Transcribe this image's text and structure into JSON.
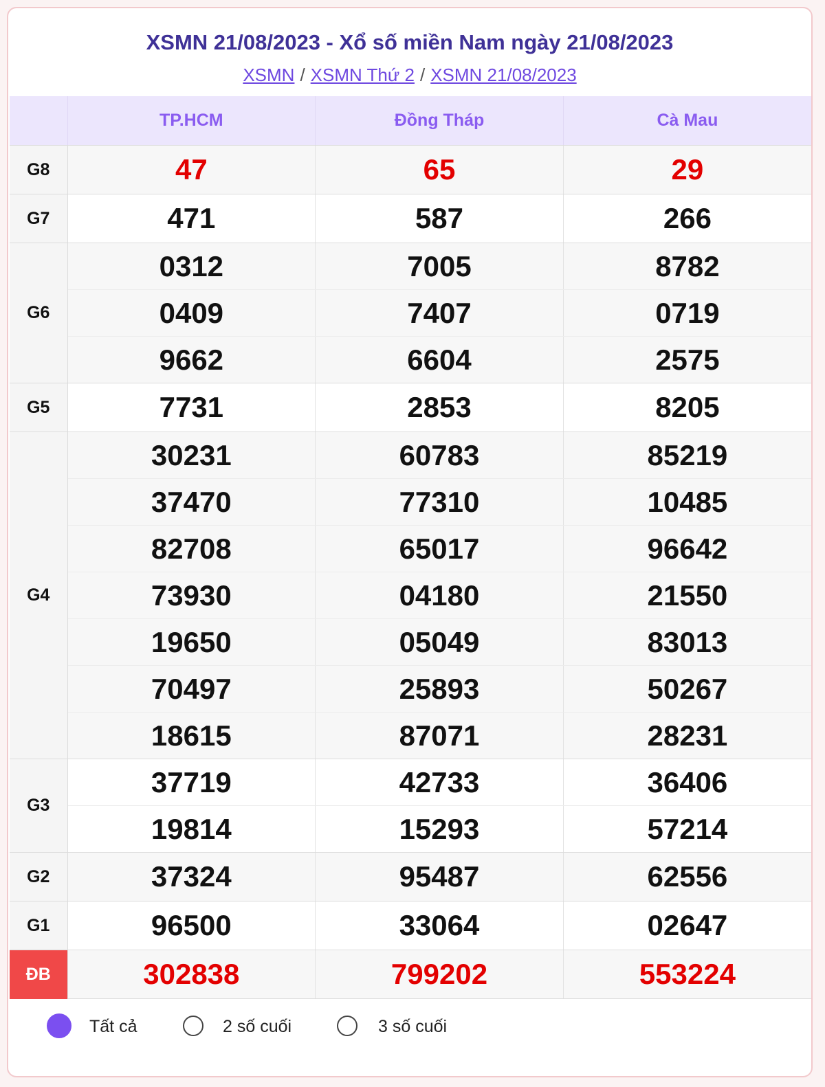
{
  "header": {
    "title": "XSMN 21/08/2023 - Xổ số miền Nam ngày 21/08/2023",
    "breadcrumbs": [
      "XSMN",
      "XSMN Thứ 2",
      "XSMN 21/08/2023"
    ]
  },
  "table": {
    "provinces": [
      "TP.HCM",
      "Đồng Tháp",
      "Cà Mau"
    ],
    "prizes": [
      {
        "label": "G8",
        "rows": [
          [
            "47",
            "65",
            "29"
          ]
        ]
      },
      {
        "label": "G7",
        "rows": [
          [
            "471",
            "587",
            "266"
          ]
        ]
      },
      {
        "label": "G6",
        "rows": [
          [
            "0312",
            "7005",
            "8782"
          ],
          [
            "0409",
            "7407",
            "0719"
          ],
          [
            "9662",
            "6604",
            "2575"
          ]
        ]
      },
      {
        "label": "G5",
        "rows": [
          [
            "7731",
            "2853",
            "8205"
          ]
        ]
      },
      {
        "label": "G4",
        "rows": [
          [
            "30231",
            "60783",
            "85219"
          ],
          [
            "37470",
            "77310",
            "10485"
          ],
          [
            "82708",
            "65017",
            "96642"
          ],
          [
            "73930",
            "04180",
            "21550"
          ],
          [
            "19650",
            "05049",
            "83013"
          ],
          [
            "70497",
            "25893",
            "50267"
          ],
          [
            "18615",
            "87071",
            "28231"
          ]
        ]
      },
      {
        "label": "G3",
        "rows": [
          [
            "37719",
            "42733",
            "36406"
          ],
          [
            "19814",
            "15293",
            "57214"
          ]
        ]
      },
      {
        "label": "G2",
        "rows": [
          [
            "37324",
            "95487",
            "62556"
          ]
        ]
      },
      {
        "label": "G1",
        "rows": [
          [
            "96500",
            "33064",
            "02647"
          ]
        ]
      },
      {
        "label": "ĐB",
        "rows": [
          [
            "302838",
            "799202",
            "553224"
          ]
        ]
      }
    ]
  },
  "filters": {
    "options": [
      "Tất cả",
      "2 số cuối",
      "3 số cuối"
    ],
    "selected": "Tất cả"
  },
  "colors": {
    "title": "#3f3197",
    "link": "#6e48e0",
    "header_bg": "#ece6fd",
    "header_text": "#8a5cf0",
    "highlight_red": "#e30000",
    "special_label_bg": "#f04848",
    "radio_selected": "#7b4ff0"
  }
}
